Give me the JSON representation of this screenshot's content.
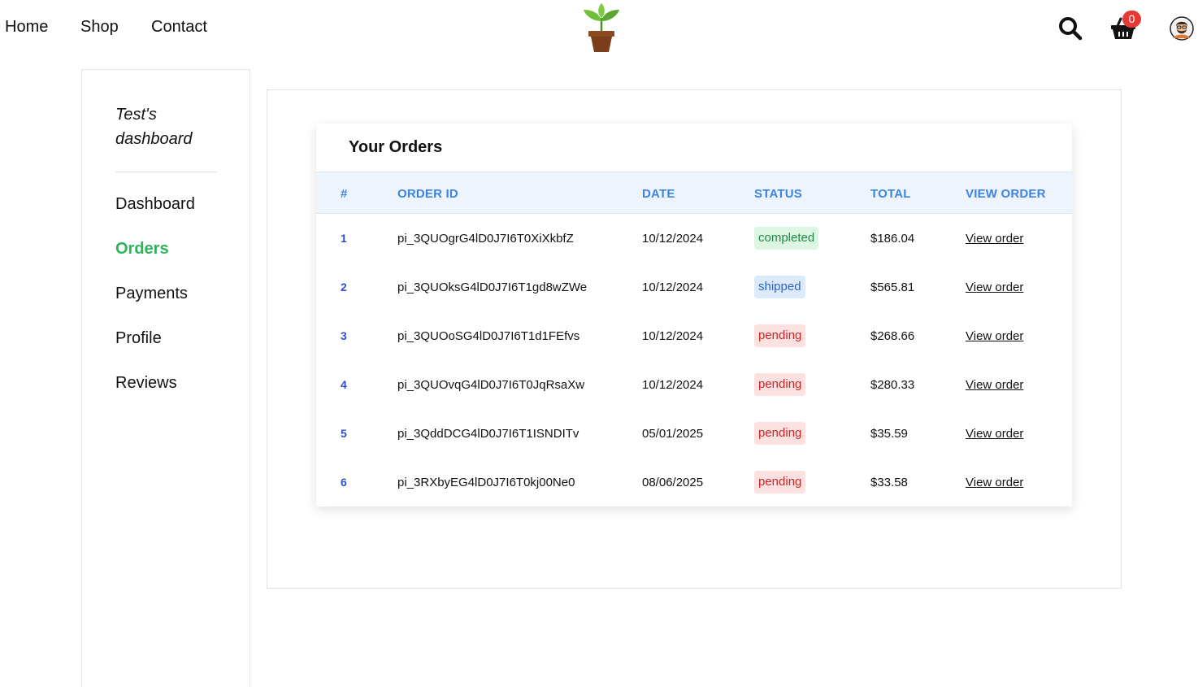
{
  "nav": {
    "home": "Home",
    "shop": "Shop",
    "contact": "Contact"
  },
  "header": {
    "logo_icon": "potted-plant-icon",
    "search_icon": "search-icon",
    "cart_icon": "basket-icon",
    "cart_count": "0",
    "avatar_icon": "user-avatar-icon"
  },
  "sidebar": {
    "title": "Test's dashboard",
    "items": [
      {
        "label": "Dashboard",
        "active": false
      },
      {
        "label": "Orders",
        "active": true
      },
      {
        "label": "Payments",
        "active": false
      },
      {
        "label": "Profile",
        "active": false
      },
      {
        "label": "Reviews",
        "active": false
      }
    ]
  },
  "orders": {
    "title": "Your Orders",
    "columns": [
      "#",
      "ORDER ID",
      "DATE",
      "STATUS",
      "TOTAL",
      "VIEW ORDER"
    ],
    "rows": [
      {
        "num": "1",
        "id": "pi_3QUOgrG4lD0J7I6T0XiXkbfZ",
        "date": "10/12/2024",
        "status": "completed",
        "total": "$186.04",
        "link": "View order"
      },
      {
        "num": "2",
        "id": "pi_3QUOksG4lD0J7I6T1gd8wZWe",
        "date": "10/12/2024",
        "status": "shipped",
        "total": "$565.81",
        "link": "View order"
      },
      {
        "num": "3",
        "id": "pi_3QUOoSG4lD0J7I6T1d1FEfvs",
        "date": "10/12/2024",
        "status": "pending",
        "total": "$268.66",
        "link": "View order"
      },
      {
        "num": "4",
        "id": "pi_3QUOvqG4lD0J7I6T0JqRsaXw",
        "date": "10/12/2024",
        "status": "pending",
        "total": "$280.33",
        "link": "View order"
      },
      {
        "num": "5",
        "id": "pi_3QddDCG4lD0J7I6T1ISNDITv",
        "date": "05/01/2025",
        "status": "pending",
        "total": "$35.59",
        "link": "View order"
      },
      {
        "num": "6",
        "id": "pi_3RXbyEG4lD0J7I6T0kj00Ne0",
        "date": "08/06/2025",
        "status": "pending",
        "total": "$33.58",
        "link": "View order"
      }
    ]
  },
  "colors": {
    "accent_green": "#2bb45a",
    "header_blue": "#3d83e3",
    "badge_red": "#e53935"
  }
}
